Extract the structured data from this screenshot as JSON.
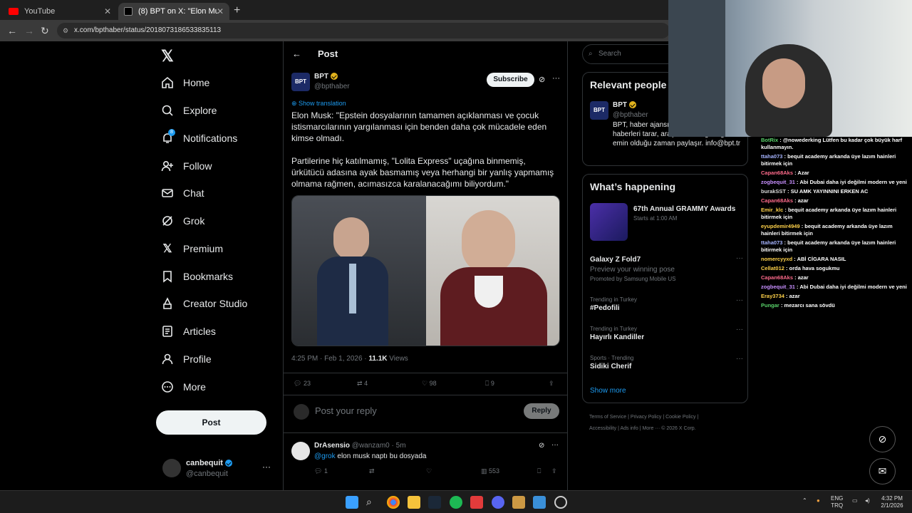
{
  "browser": {
    "tabs": [
      {
        "title": "YouTube"
      },
      {
        "title": "(8) BPT on X: \"Elon Musk: \"Epstein"
      }
    ],
    "url": "x.com/bpthaber/status/2018073186533835113"
  },
  "nav": {
    "items": [
      "Home",
      "Explore",
      "Notifications",
      "Follow",
      "Chat",
      "Grok",
      "Premium",
      "Bookmarks",
      "Creator Studio",
      "Articles",
      "Profile",
      "More"
    ],
    "notifications_badge": "8",
    "post_button": "Post"
  },
  "account": {
    "name": "canbequit",
    "handle": "@canbequit"
  },
  "post_header": {
    "title": "Post"
  },
  "tweet": {
    "author_name": "BPT",
    "author_handle": "@bpthaber",
    "avatar_text": "BPT",
    "subscribe_label": "Subscribe",
    "show_translation": "Show translation",
    "text": "Elon Musk: \"Epstein dosyalarının tamamen açıklanması ve çocuk istismarcılarının yargılanması için benden daha çok mücadele eden kimse olmadı.\n\nPartilerine hiç katılmamış, \"Lolita Express\" uçağına binmemiş, ürkütücü adasına ayak basmamış veya herhangi bir yanlış yapmamış olmama rağmen, acımasızca karalanacağımı biliyordum.\"",
    "time": "4:25 PM · Feb 1, 2026 · ",
    "views": "11.1K",
    "views_label": " Views",
    "replies": "23",
    "reposts": "4",
    "likes": "98",
    "bookmarks": "9"
  },
  "reply_composer": {
    "placeholder": "Post your reply",
    "button": "Reply"
  },
  "reply": {
    "name": "DrAsensio",
    "meta": "@wanzam0 · 5m",
    "mention": "@grok",
    "text": " elon musk naptı bu dosyada",
    "replies": "1",
    "views": "553"
  },
  "search": {
    "placeholder": "Search"
  },
  "relevant": {
    "title": "Relevant people",
    "name": "BPT",
    "handle": "@bpthaber",
    "bio": "BPT, haber ajansı... internette yer alan haberleri tarar, araştırır ve doğruluğundan emin olduğu zaman paylaşır. info@bpt.tr"
  },
  "happening": {
    "title": "What’s happening",
    "event_title": "67th Annual GRAMMY Awards",
    "event_sub": "Starts at 1:00 AM",
    "promo_title": "Galaxy Z Fold7",
    "promo_sub": "Preview your winning pose",
    "promo_by": "Promoted by Samsung Mobile US",
    "trends": [
      {
        "context": "Trending in Turkey",
        "title": "#Pedofili"
      },
      {
        "context": "Trending in Turkey",
        "title": "Hayırlı Kandiller"
      },
      {
        "context": "Sports · Trending",
        "title": "Sidiki Cherif"
      }
    ],
    "show_more": "Show more"
  },
  "footer": {
    "line1": "Terms of Service  |  Privacy Policy  |  Cookie Policy  |",
    "line2": "Accessibility  |  Ads info  |  More ···  © 2026 X Corp."
  },
  "chat": [
    {
      "user": "BotRix",
      "msg": ": @nowederking Lütfen bu kadar çok büyük harf kullanmayın.",
      "color": "#59d36a"
    },
    {
      "user": "ttaha073",
      "msg": ": bequit academy arkanda üye lazım hainleri bitirmek için",
      "color": "#a6b4ff"
    },
    {
      "user": "Capan68Aks",
      "msg": ": Azar",
      "color": "#ff6b8b"
    },
    {
      "user": "zogbequit_31",
      "msg": ": Abi Dubai daha iyi değilmi modern ve yeni",
      "color": "#c890ff"
    },
    {
      "user": "burakSST",
      "msg": ": SU AMK YAYINNINI ERKEN AC",
      "color": "#d8d8d8"
    },
    {
      "user": "Capan68Aks",
      "msg": ": azar",
      "color": "#ff6b8b"
    },
    {
      "user": "Emir_klc",
      "msg": ": bequit academy arkanda üye lazım hainleri bitirmek için",
      "color": "#ffd24a"
    },
    {
      "user": "eyupdemir4949",
      "msg": ": bequit academy arkanda üye lazım hainleri bitirmek için",
      "color": "#ffd24a"
    },
    {
      "user": "ttaha073",
      "msg": ": bequit academy arkanda üye lazım hainleri bitirmek için",
      "color": "#a6b4ff"
    },
    {
      "user": "nomercyyxd",
      "msg": ": ABİ CİGARA NASIL",
      "color": "#ffd24a"
    },
    {
      "user": "Cellat012",
      "msg": ": orda hava sogukmu",
      "color": "#ffd24a"
    },
    {
      "user": "Capan68Aks",
      "msg": ": azar",
      "color": "#ff6b8b"
    },
    {
      "user": "zogbequit_31",
      "msg": ": Abi Dubai daha iyi değilmi modern ve yeni",
      "color": "#c890ff"
    },
    {
      "user": "Eray3734",
      "msg": ": azar",
      "color": "#ffd24a"
    },
    {
      "user": "Pungar",
      "msg": ": mezarcı sana sövdü",
      "color": "#59d36a"
    }
  ],
  "tray": {
    "lang1": "ENG",
    "lang2": "TRQ",
    "time": "4:32 PM",
    "date": "2/1/2026"
  }
}
